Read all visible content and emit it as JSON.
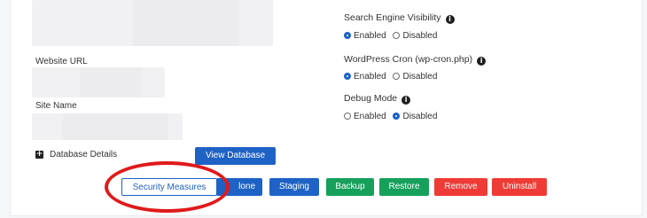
{
  "left": {
    "website_url_label": "Website URL",
    "site_name_label": "Site Name",
    "database_details_label": "Database Details",
    "view_database_label": "View Database"
  },
  "settings": {
    "search_engine": {
      "title": "Search Engine Visibility",
      "options": [
        "Enabled",
        "Disabled"
      ],
      "selected": "Enabled"
    },
    "wp_cron": {
      "title": "WordPress Cron (wp-cron.php)",
      "options": [
        "Enabled",
        "Disabled"
      ],
      "selected": "Enabled"
    },
    "debug_mode": {
      "title": "Debug Mode",
      "options": [
        "Enabled",
        "Disabled"
      ],
      "selected": "Disabled"
    }
  },
  "actions": {
    "security_measures": "Security Measures",
    "clone": "lone",
    "staging": "Staging",
    "backup": "Backup",
    "restore": "Restore",
    "remove": "Remove",
    "uninstall": "Uninstall"
  },
  "colors": {
    "primary_blue": "#1e62c6",
    "green": "#16a05b",
    "red": "#ef3b35",
    "highlight_red": "#e01a1a"
  },
  "icons": {
    "info": "info-icon",
    "expand": "plus-square-icon"
  }
}
